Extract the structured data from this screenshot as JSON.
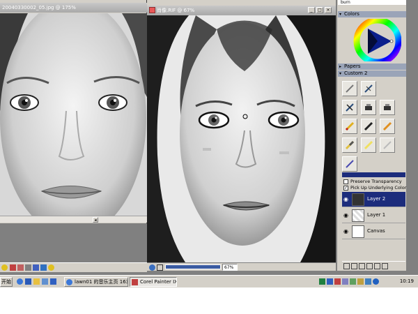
{
  "left_window": {
    "title": "20040330002_05.jpg @ 175%",
    "scroll_arrow": "◂"
  },
  "center_window": {
    "title": "肖像.RIF @ 67%",
    "zoom": "67%",
    "minimize": "_",
    "maximize": "□",
    "close": "×"
  },
  "palette": {
    "top_item": "burn",
    "colors_header": "Colors",
    "papers_header": "Papers",
    "custom_header": "Custom 2",
    "brush_icons": [
      "pen-icon",
      "eraser-icon",
      "cross-icon",
      "sponge-icon",
      "sponge-icon",
      "pencil-yellow-icon",
      "pencil-black-icon",
      "pencil-orange-icon",
      "marker-icon",
      "highlighter-icon",
      "knife-icon",
      "blender-icon"
    ]
  },
  "layers": {
    "preserve_transparency": "Preserve Transparency",
    "pick_up_color": "Pick Up Underlying Color",
    "pick_up_checked": true,
    "preserve_checked": false,
    "items": [
      {
        "name": "Layer 2",
        "selected": true
      },
      {
        "name": "Layer 1",
        "selected": false
      },
      {
        "name": "Canvas",
        "selected": false
      }
    ]
  },
  "taskbar": {
    "start": "开始",
    "task1": "lawn01 的音乐主页 1638...",
    "task2": "Corel Painter IX",
    "clock": "10:19"
  }
}
